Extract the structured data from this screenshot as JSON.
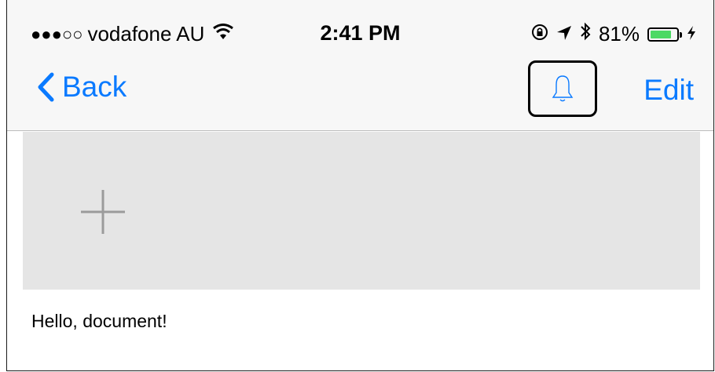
{
  "status_bar": {
    "signal_dots": "●●●○○",
    "carrier": "vodafone AU",
    "time": "2:41 PM",
    "battery_percent": "81%",
    "battery_level": 0.81,
    "icons": [
      "signal-icon",
      "wifi-icon",
      "rotation-lock-icon",
      "location-icon",
      "bluetooth-icon",
      "battery-icon",
      "charging-icon"
    ]
  },
  "nav_bar": {
    "back_label": "Back",
    "edit_label": "Edit",
    "bell_icon": "bell-icon",
    "tint_color": "#0a7aff"
  },
  "content": {
    "add_icon": "plus-icon",
    "text": "Hello, document!"
  }
}
